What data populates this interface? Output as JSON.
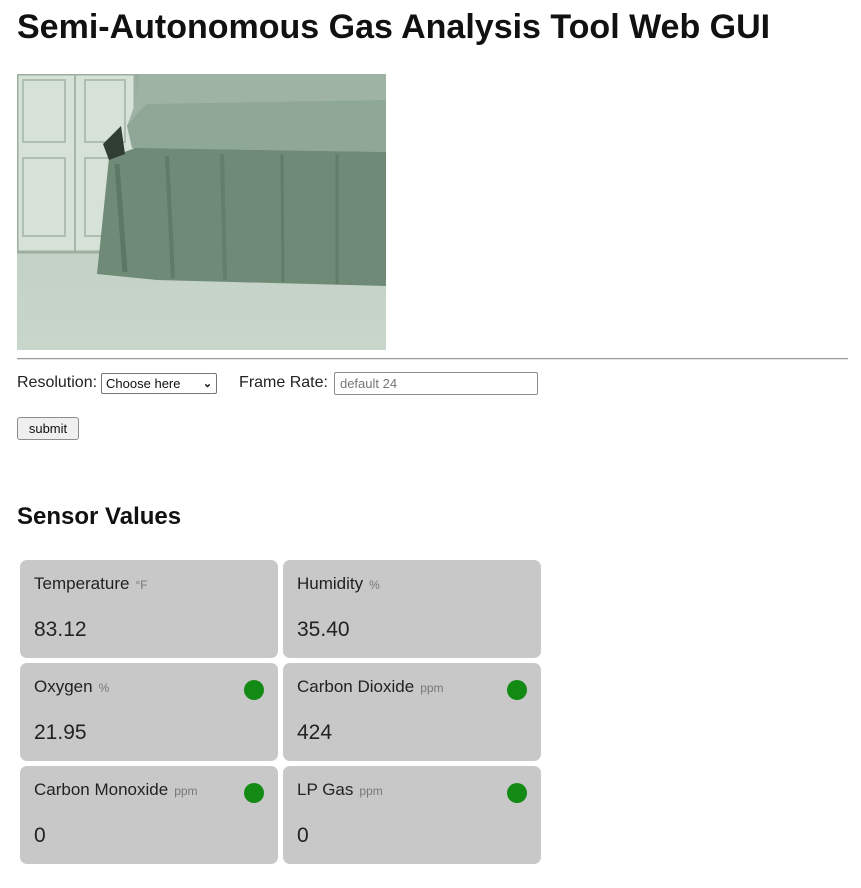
{
  "title": "Semi-Autonomous Gas Analysis Tool Web GUI",
  "controls": {
    "resolution_label": "Resolution:",
    "resolution_value": "Choose here",
    "frame_rate_label": "Frame Rate:",
    "frame_rate_placeholder": "default 24",
    "submit_label": "submit"
  },
  "sensors": {
    "heading": "Sensor Values",
    "status_color": "#138a13",
    "cards": [
      {
        "label": "Temperature",
        "unit": "°F",
        "value": "83.12",
        "status": false
      },
      {
        "label": "Humidity",
        "unit": "%",
        "value": "35.40",
        "status": false
      },
      {
        "label": "Oxygen",
        "unit": "%",
        "value": "21.95",
        "status": true
      },
      {
        "label": "Carbon Dioxide",
        "unit": "ppm",
        "value": "424",
        "status": true
      },
      {
        "label": "Carbon Monoxide",
        "unit": "ppm",
        "value": "0",
        "status": true
      },
      {
        "label": "LP Gas",
        "unit": "ppm",
        "value": "0",
        "status": true
      }
    ]
  }
}
